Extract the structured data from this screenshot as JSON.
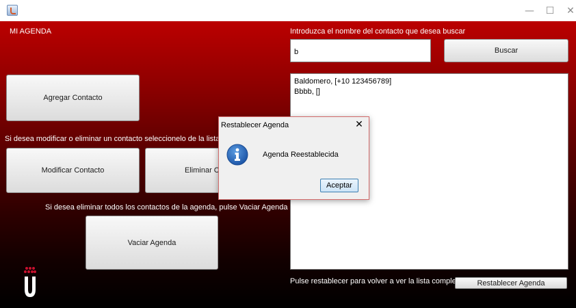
{
  "window": {
    "minimize": "—",
    "maximize": "☐",
    "close": "✕"
  },
  "header": {
    "app_title": "MI AGENDA",
    "search_prompt": "Introduzca el nombre del contacto que desea buscar"
  },
  "search": {
    "value": "b",
    "button": "Buscar"
  },
  "actions": {
    "add": "Agregar Contacto",
    "modify_hint": "Si desea modificar o eliminar un contacto seleccionelo de la lista y d",
    "modify": "Modificar Contacto",
    "delete": "Eliminar Co",
    "clear_hint": "Si desea eliminar todos los contactos de la agenda, pulse Vaciar Agenda",
    "clear": "Vaciar Agenda"
  },
  "contacts": [
    "Baldomero, [+10 123456789]",
    "Bbbb, []"
  ],
  "footer": {
    "reset_hint": "Pulse restablecer para volver a ver la lista completa",
    "reset_button": "Restablecer Agenda"
  },
  "dialog": {
    "title": "Restablecer Agenda",
    "close": "✕",
    "message": "Agenda Reestablecida",
    "ok": "Aceptar",
    "icon": "info-icon"
  },
  "colors": {
    "gradient_top": "#bb0000",
    "gradient_bottom": "#000000",
    "logo_red": "#c8102e",
    "info_blue": "#2b6fc0"
  }
}
